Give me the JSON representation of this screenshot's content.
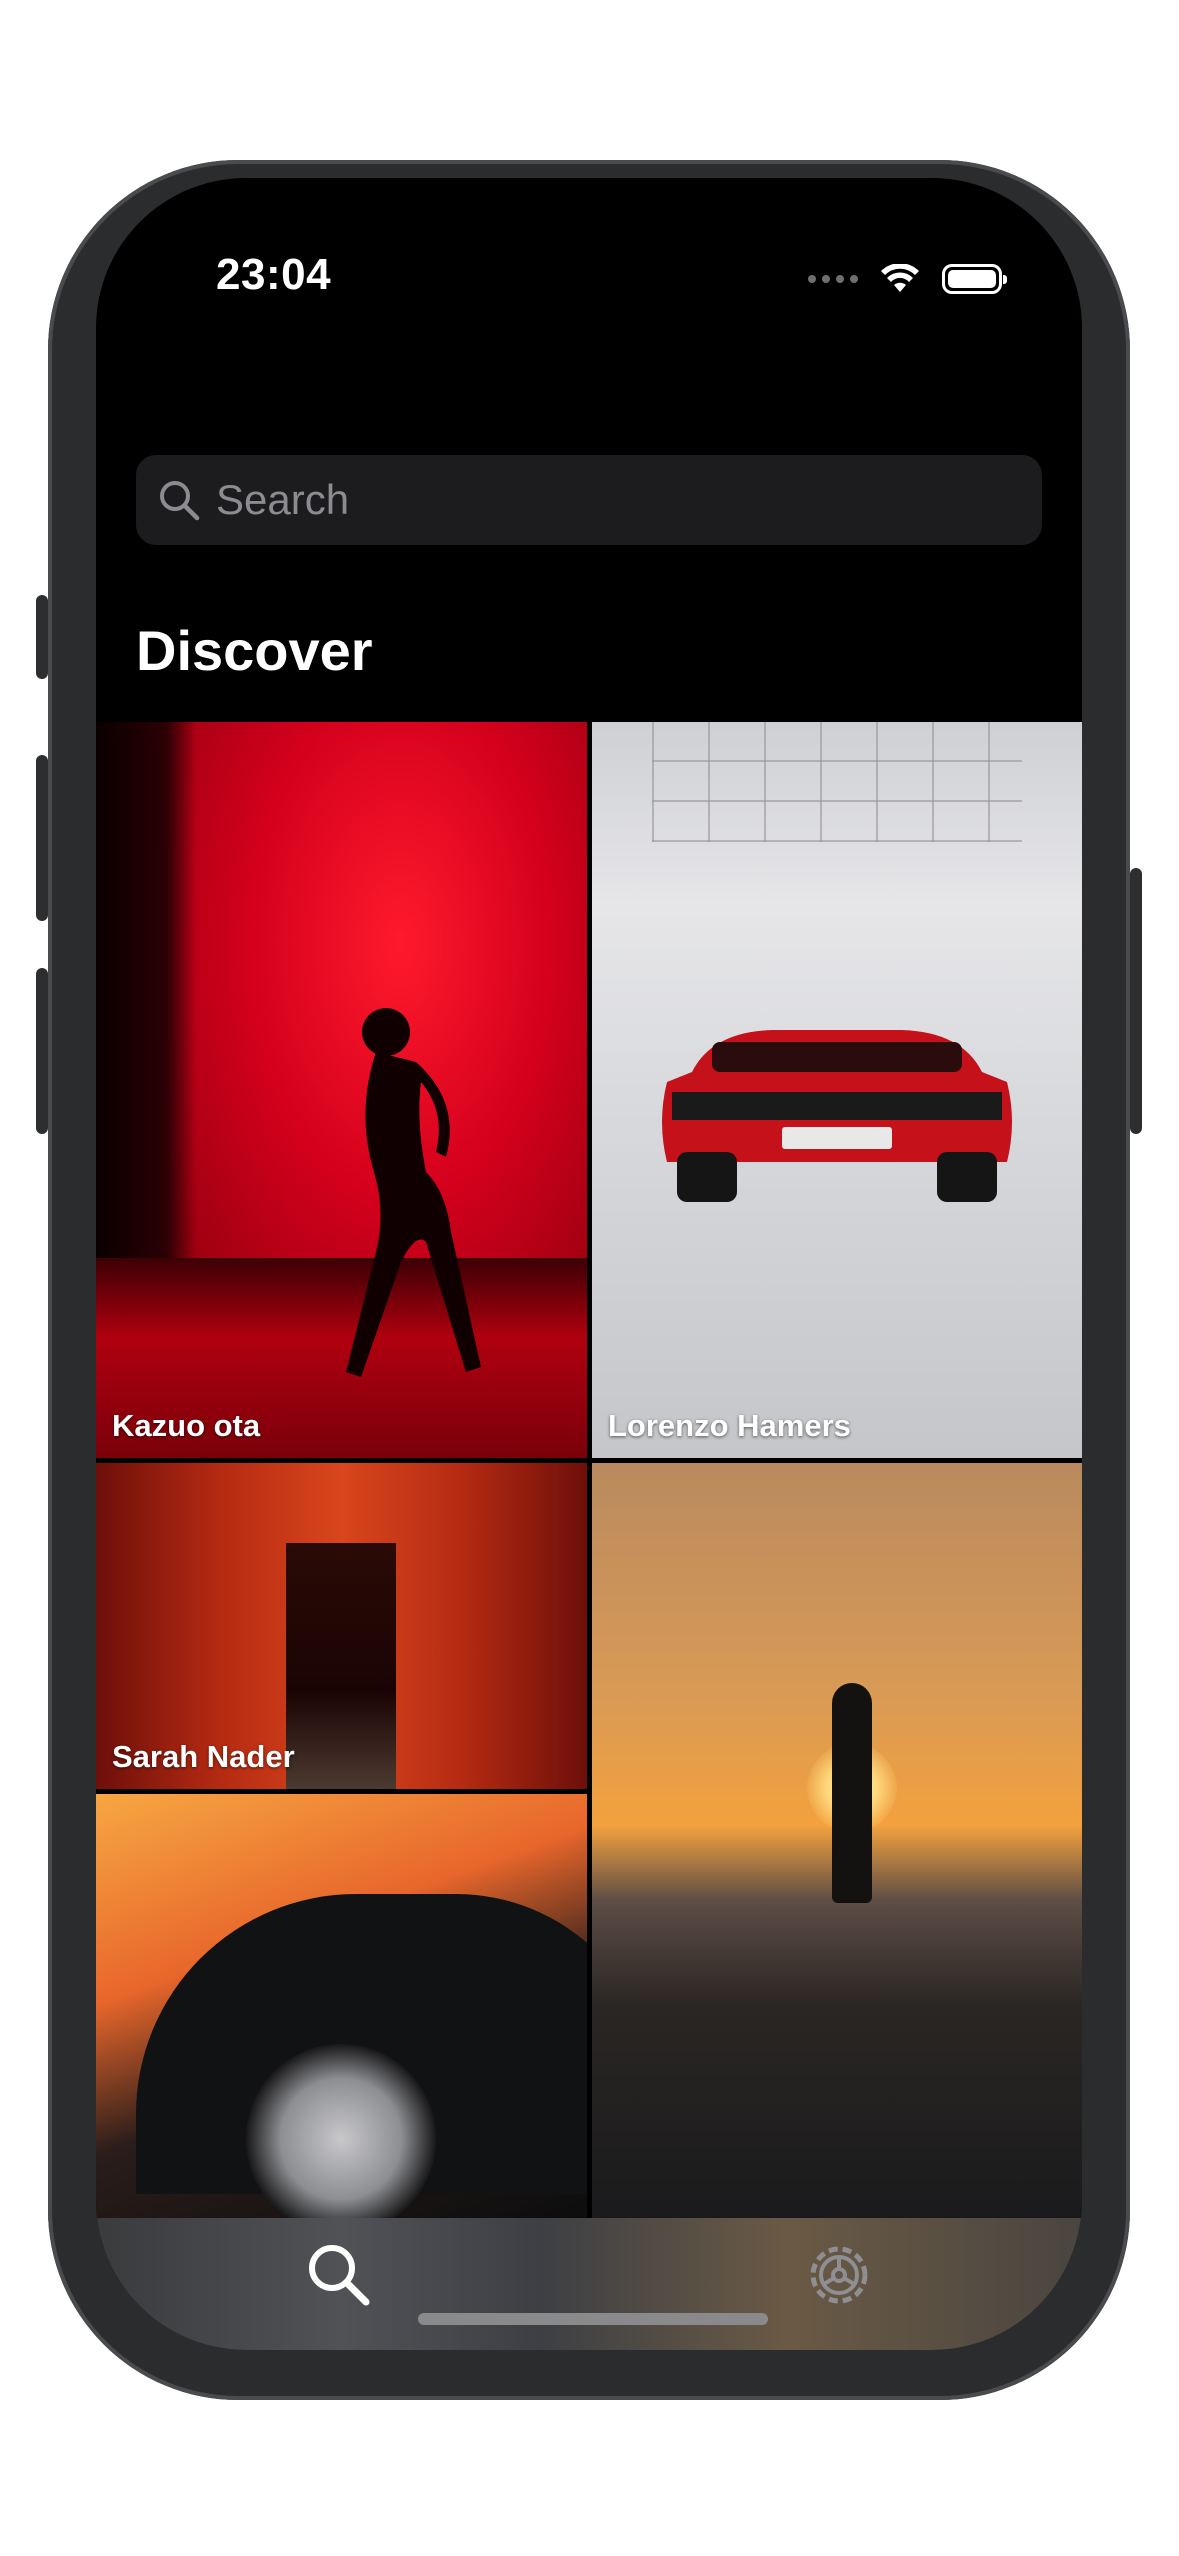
{
  "status_bar": {
    "time": "23:04"
  },
  "search": {
    "placeholder": "Search"
  },
  "page": {
    "title": "Discover"
  },
  "photos": [
    {
      "credit": "Kazuo ota"
    },
    {
      "credit": "Lorenzo Hamers"
    },
    {
      "credit": "Sarah Nader"
    },
    {
      "credit": ""
    },
    {
      "credit": ""
    }
  ],
  "tab_bar": {
    "items": [
      {
        "icon": "search-icon",
        "active": true
      },
      {
        "icon": "gear-icon",
        "active": false
      }
    ]
  },
  "colors": {
    "background": "#000000",
    "search_field": "#1c1c1e",
    "placeholder": "#8b8b90",
    "inactive_tab": "#8e8e93"
  }
}
